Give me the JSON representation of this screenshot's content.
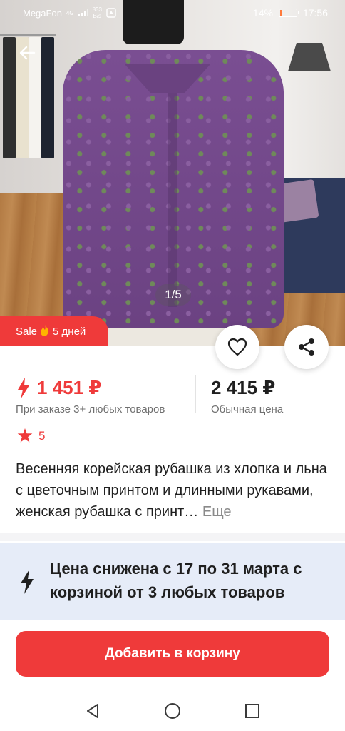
{
  "status_bar": {
    "carrier": "MegaFon",
    "network": "4G",
    "speed_value": "833",
    "speed_unit": "B/s",
    "battery_percent": "14%",
    "battery_level": 0.14,
    "time": "17:56"
  },
  "gallery": {
    "counter": "1/5",
    "image_icon": "product-photo"
  },
  "sale_badge": {
    "label": "Sale",
    "icon": "fire-icon",
    "duration": "5 дней"
  },
  "price": {
    "deal_amount": "1 451 ₽",
    "deal_note": "При заказе 3+ любых товаров",
    "regular_amount": "2 415 ₽",
    "regular_note": "Обычная цена",
    "accent_color": "#ef3a3a"
  },
  "rating": {
    "value": "5",
    "icon": "star-icon"
  },
  "product": {
    "title": "Весенняя корейская рубашка из хлопка и льна с цветочным принтом и длинными рукавами, женская рубашка с принт…",
    "more_label": "Еще"
  },
  "promo": {
    "text": "Цена снижена с 17 по 31 марта с корзиной от 3 любых товаров",
    "icon": "bolt-icon",
    "background": "#e6ecf8"
  },
  "actions": {
    "add_to_cart": "Добавить в корзину",
    "favorite_icon": "heart-icon",
    "share_icon": "share-icon",
    "back_icon": "back-arrow-icon"
  },
  "navigation": {
    "back": "triangle-back-icon",
    "home": "circle-home-icon",
    "recents": "square-recents-icon"
  }
}
